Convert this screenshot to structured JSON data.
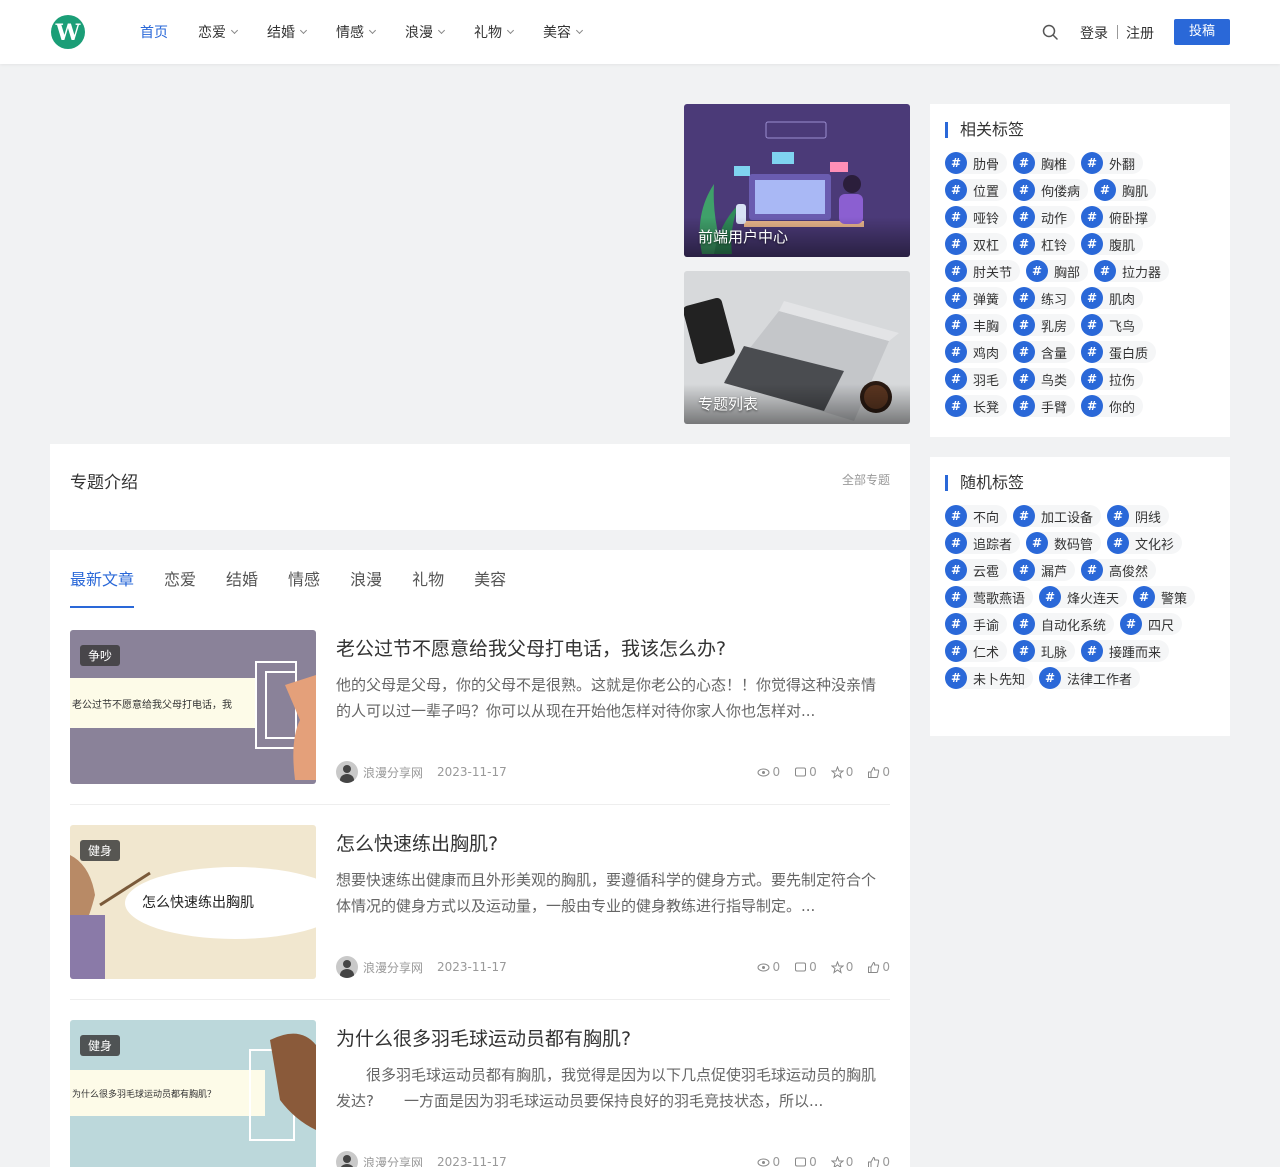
{
  "colors": {
    "accent": "#2a68d8"
  },
  "header": {
    "logo_icon": "w-logo-icon",
    "nav": [
      {
        "label": "首页",
        "active": true,
        "dropdown": false
      },
      {
        "label": "恋爱",
        "dropdown": true
      },
      {
        "label": "结婚",
        "dropdown": true
      },
      {
        "label": "情感",
        "dropdown": true
      },
      {
        "label": "浪漫",
        "dropdown": true
      },
      {
        "label": "礼物",
        "dropdown": true
      },
      {
        "label": "美容",
        "dropdown": true
      }
    ],
    "search_icon": "search-icon",
    "login": "登录",
    "register": "注册",
    "submit": "投稿"
  },
  "feature_cards": [
    {
      "label": "前端用户中心"
    },
    {
      "label": "专题列表"
    }
  ],
  "sidebar": {
    "related": {
      "title": "相关标签",
      "tags": [
        "肋骨",
        "胸椎",
        "外翻",
        "位置",
        "佝偻病",
        "胸肌",
        "哑铃",
        "动作",
        "俯卧撑",
        "双杠",
        "杠铃",
        "腹肌",
        "肘关节",
        "胸部",
        "拉力器",
        "弹簧",
        "练习",
        "肌肉",
        "丰胸",
        "乳房",
        "飞鸟",
        "鸡肉",
        "含量",
        "蛋白质",
        "羽毛",
        "鸟类",
        "拉伤",
        "长凳",
        "手臂",
        "你的"
      ]
    },
    "random": {
      "title": "随机标签",
      "tags": [
        "不向",
        "加工设备",
        "阴线",
        "追踪者",
        "数码管",
        "文化衫",
        "云雹",
        "漏芦",
        "高俊然",
        "莺歌燕语",
        "烽火连天",
        "警策",
        "手谕",
        "自动化系统",
        "四尺",
        "仁术",
        "玌脉",
        "接踵而来",
        "未卜先知",
        "法律工作者"
      ]
    }
  },
  "topic": {
    "title": "专题介绍",
    "all_link": "全部专题"
  },
  "tabs": [
    "最新文章",
    "恋爱",
    "结婚",
    "情感",
    "浪漫",
    "礼物",
    "美容"
  ],
  "posts": [
    {
      "badge": "争吵",
      "thumb_text": "老公过节不愿意给我父母打电话，我",
      "title": "老公过节不愿意给我父母打电话，我该怎么办?",
      "excerpt": "他的父母是父母，你的父母不是很熟。这就是你老公的心态！！你觉得这种没亲情的人可以过一辈子吗？你可以从现在开始他怎样对待你家人你也怎样对...",
      "author": "浪漫分享网",
      "date": "2023-11-17",
      "views": "0",
      "comments": "0",
      "favorites": "0",
      "likes": "0"
    },
    {
      "badge": "健身",
      "thumb_text": "怎么快速练出胸肌",
      "title": "怎么快速练出胸肌?",
      "excerpt": "想要快速练出健康而且外形美观的胸肌，要遵循科学的健身方式。要先制定符合个体情况的健身方式以及运动量，一般由专业的健身教练进行指导制定。...",
      "author": "浪漫分享网",
      "date": "2023-11-17",
      "views": "0",
      "comments": "0",
      "favorites": "0",
      "likes": "0"
    },
    {
      "badge": "健身",
      "thumb_text": "为什么很多羽毛球运动员都有胸肌？",
      "title": "为什么很多羽毛球运动员都有胸肌?",
      "excerpt": "　　很多羽毛球运动员都有胸肌，我觉得是因为以下几点促使羽毛球运动员的胸肌发达?　　一方面是因为羽毛球运动员要保持良好的羽毛竞技状态，所以...",
      "author": "浪漫分享网",
      "date": "2023-11-17",
      "views": "0",
      "comments": "0",
      "favorites": "0",
      "likes": "0"
    }
  ]
}
